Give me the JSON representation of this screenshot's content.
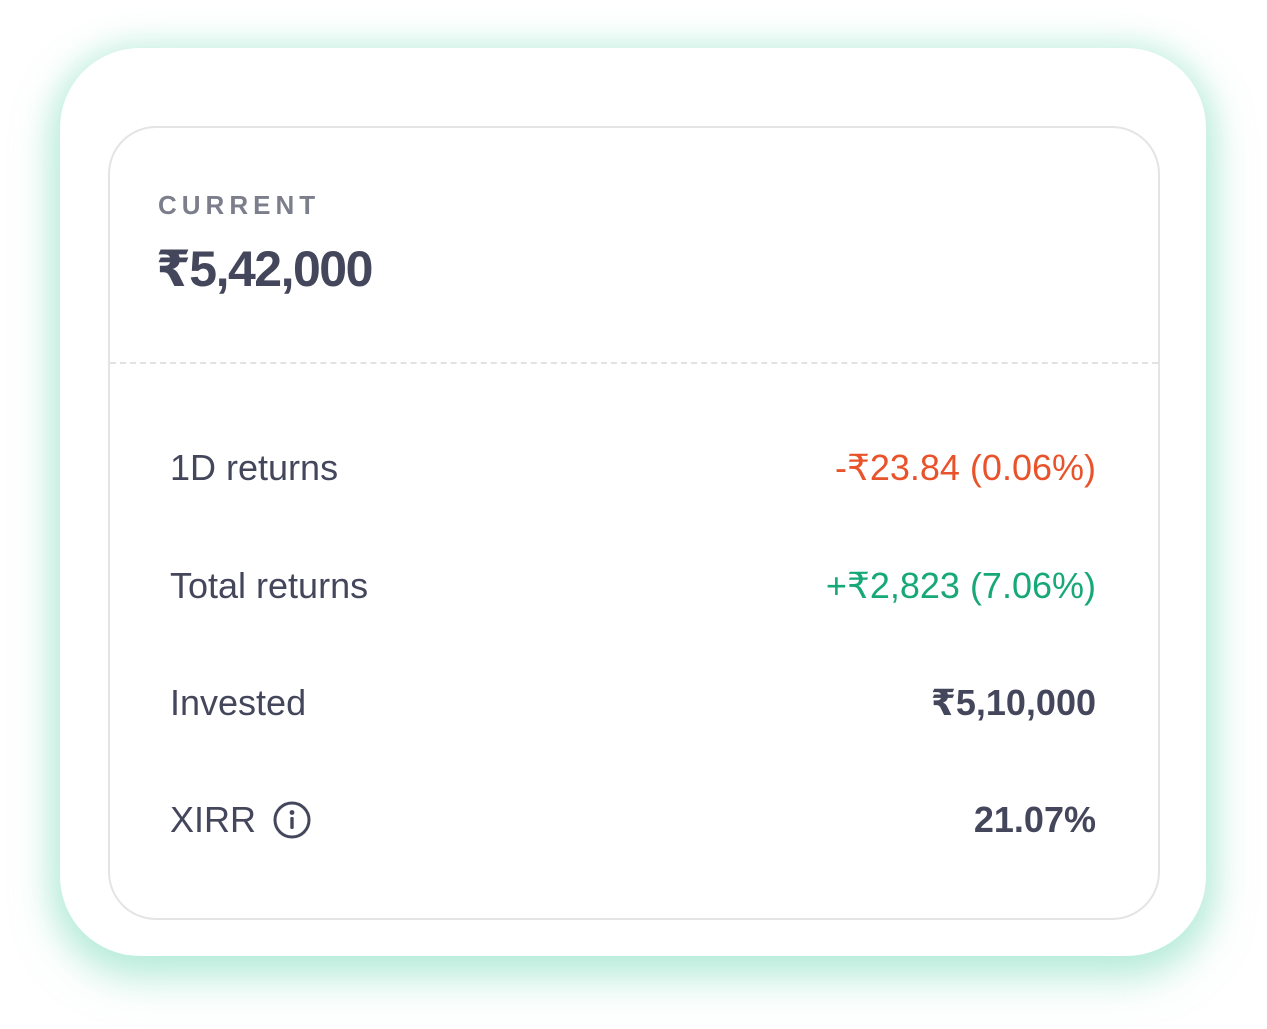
{
  "summary": {
    "current_label": "CURRENT",
    "current_value": "₹5,42,000"
  },
  "rows": [
    {
      "label": "1D returns",
      "value": "-₹23.84 (0.06%)",
      "color": "#e8532b"
    },
    {
      "label": "Total returns",
      "value": "+₹2,823 (7.06%)",
      "color": "#17a877"
    },
    {
      "label": "Invested",
      "value": "₹5,10,000",
      "color": "#44475b"
    },
    {
      "label": "XIRR",
      "value": "21.07%",
      "color": "#44475b",
      "icon": "info-icon"
    }
  ],
  "colors": {
    "negative": "#e8532b",
    "positive": "#17a877",
    "text": "#44475b",
    "label_muted": "#7c7e8c"
  }
}
